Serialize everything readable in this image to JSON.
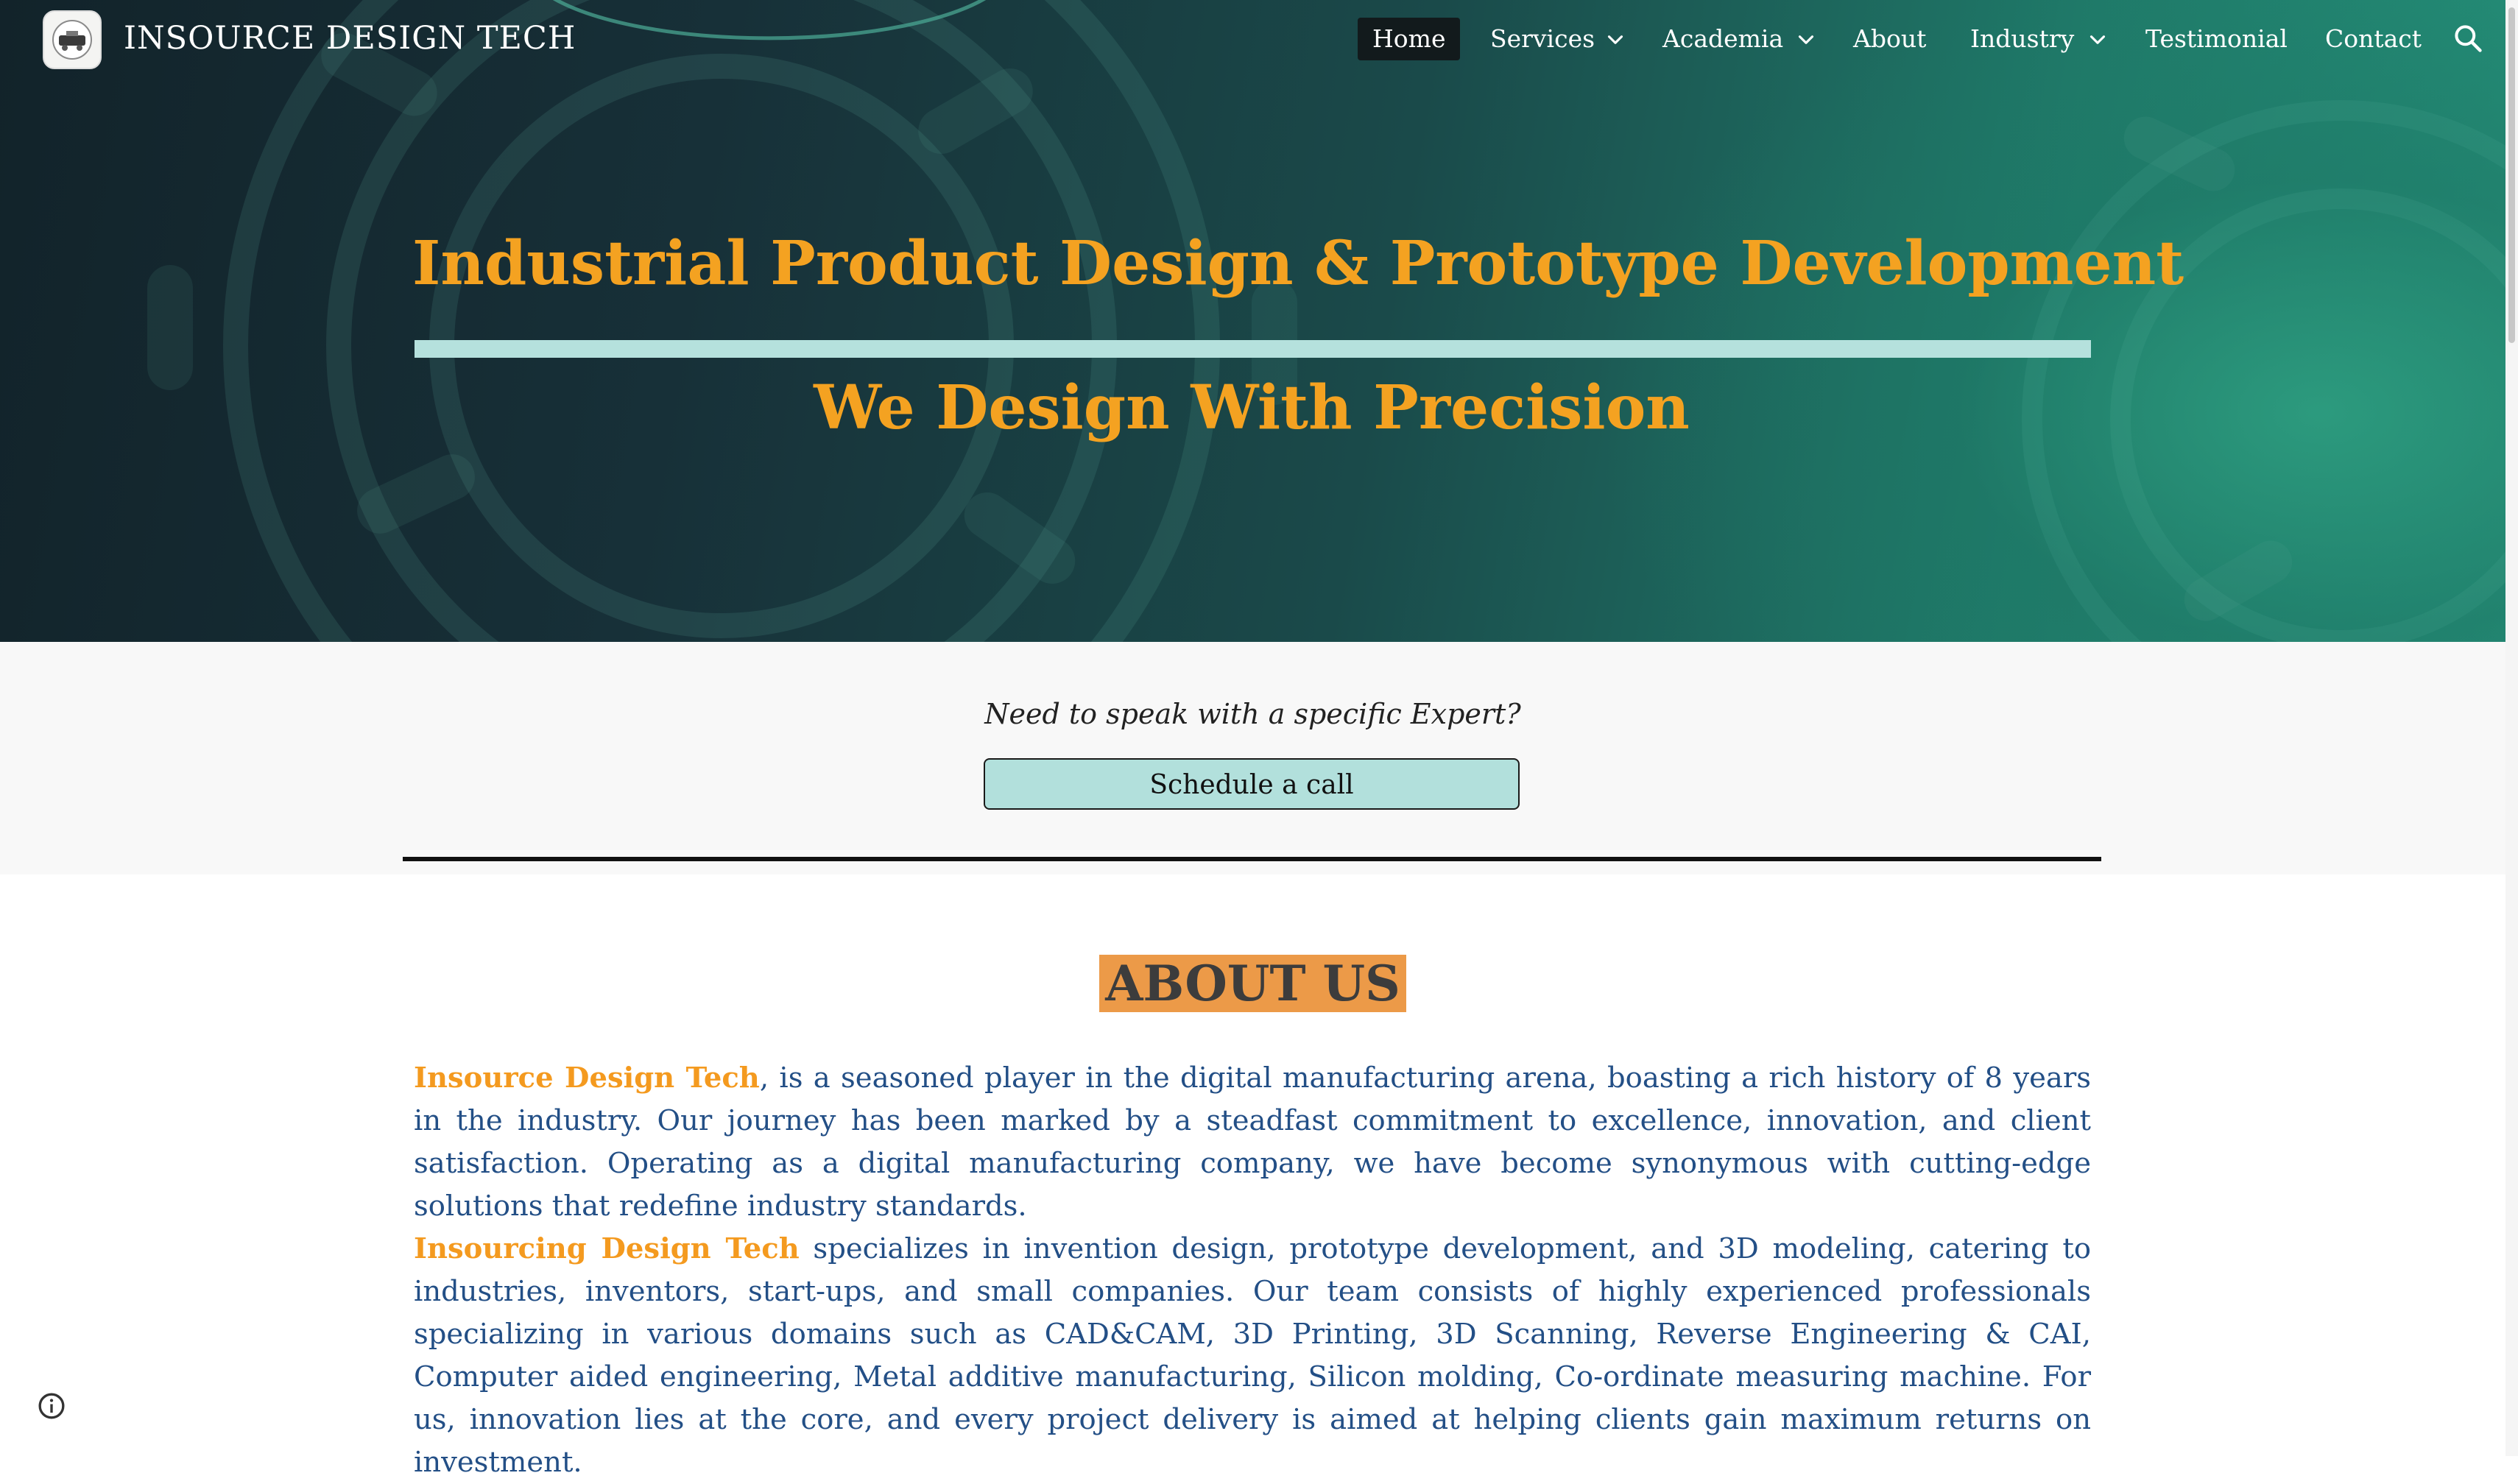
{
  "header": {
    "site_title": "INSOURCE DESIGN TECH",
    "logo_icon": "company-logo",
    "nav": [
      {
        "label": "Home",
        "active": true,
        "has_dropdown": false
      },
      {
        "label": "Services",
        "active": false,
        "has_dropdown": true
      },
      {
        "label": "Academia",
        "active": false,
        "has_dropdown": true
      },
      {
        "label": "About",
        "active": false,
        "has_dropdown": false
      },
      {
        "label": "Industry",
        "active": false,
        "has_dropdown": true
      },
      {
        "label": "Testimonial",
        "active": false,
        "has_dropdown": false
      },
      {
        "label": "Contact",
        "active": false,
        "has_dropdown": false
      }
    ],
    "search_icon": "search-icon"
  },
  "hero": {
    "title": "Industrial Product Design & Prototype Development",
    "subtitle": "We Design With Precision"
  },
  "cta": {
    "question": "Need to speak with a specific Expert?",
    "button_label": "Schedule a call"
  },
  "about": {
    "heading": "ABOUT US",
    "paragraphs": [
      {
        "brand": "Insource Design Tech",
        "text": ", is a seasoned player in the digital manufacturing arena, boasting a rich history of 8 years in the industry. Our journey has been marked by a steadfast commitment to excellence, innovation, and client satisfaction. Operating as a digital manufacturing company, we have become synonymous with cutting-edge solutions that redefine industry standards."
      },
      {
        "brand": "Insourcing Design Tech",
        "text": " specializes in invention design, prototype development, and 3D modeling, catering to industries, inventors, start-ups, and small companies. Our team consists of highly experienced professionals specializing in various domains such as CAD&CAM, 3D Printing, 3D Scanning, Reverse Engineering & CAI, Computer aided engineering, Metal additive manufacturing, Silicon molding, Co-ordinate measuring machine. For us, innovation lies at the core, and every project delivery is aimed at helping clients gain maximum returns on investment."
      }
    ]
  },
  "footer": {
    "info_icon": "info-icon"
  },
  "colors": {
    "accent_orange": "#f4a221",
    "body_blue": "#234f86",
    "rule_teal": "#b5e1dd",
    "heading_highlight": "#ec9a48"
  }
}
